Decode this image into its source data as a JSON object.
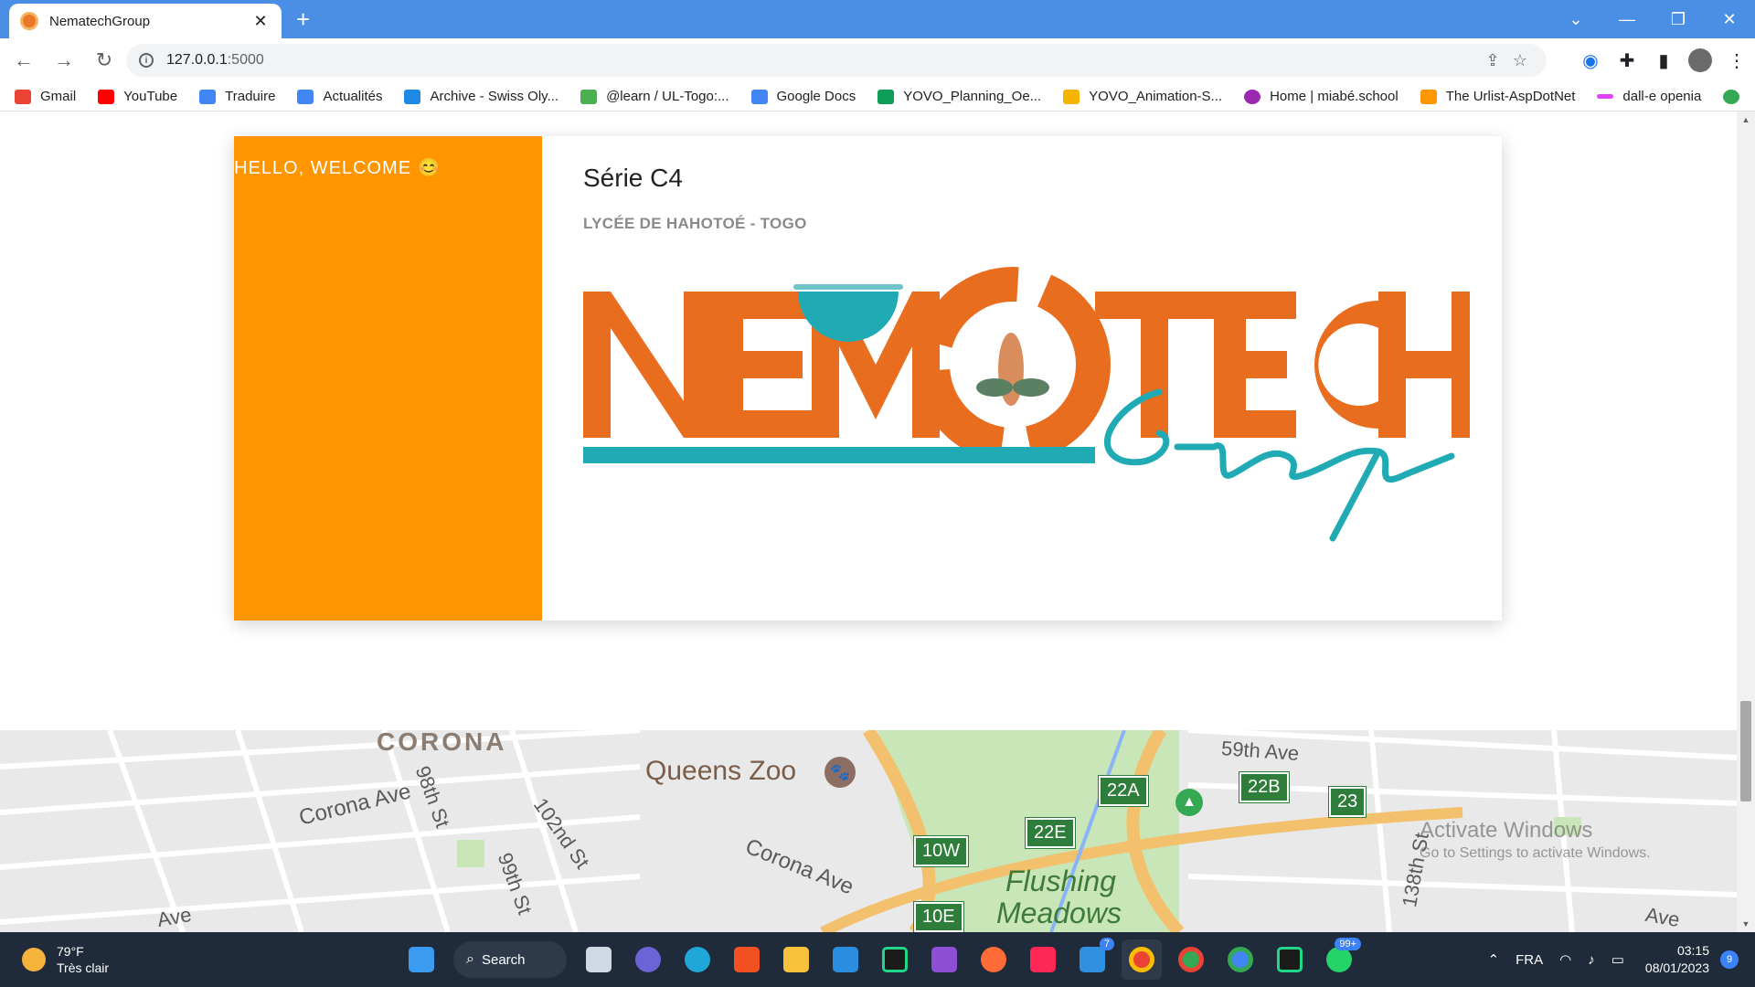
{
  "browser": {
    "tab_title": "NematechGroup",
    "tab_close": "✕",
    "new_tab": "+",
    "url_host": "127.0.0.1",
    "url_port": ":5000",
    "window_controls": [
      "⌄",
      "—",
      "❐",
      "✕"
    ],
    "nav": {
      "back": "←",
      "forward": "→",
      "reload": "↻"
    }
  },
  "bookmarks": [
    {
      "label": "Gmail",
      "color": "#ea4335"
    },
    {
      "label": "YouTube",
      "color": "#ff0000"
    },
    {
      "label": "Traduire",
      "color": "#4285f4"
    },
    {
      "label": "Actualités",
      "color": "#4285f4"
    },
    {
      "label": "Archive - Swiss Oly...",
      "color": "#1e88e5"
    },
    {
      "label": "@learn / UL-Togo:...",
      "color": "#4caf50"
    },
    {
      "label": "Google Docs",
      "color": "#4285f4"
    },
    {
      "label": "YOVO_Planning_Oe...",
      "color": "#0f9d58"
    },
    {
      "label": "YOVO_Animation-S...",
      "color": "#f4b400"
    },
    {
      "label": "Home | miabé.school",
      "color": "#9c27b0"
    },
    {
      "label": "The Urlist-AspDotNet",
      "color": "#ff9800"
    },
    {
      "label": "dall-e openia",
      "color": "#e040fb"
    }
  ],
  "page": {
    "welcome": "HELLO, WELCOME 😊",
    "serie": "Série C4",
    "school": "LYCÉE DE HAHOTOÉ - TOGO",
    "logo_text": "NEMATECH",
    "logo_script": "Group",
    "brand_orange": "#e96d1f",
    "brand_teal": "#20aab4",
    "sidebar_color": "#ff9500"
  },
  "map": {
    "labels": {
      "corona": "CORONA",
      "queens_zoo": "Queens Zoo",
      "fifty_ninth": "59th Ave",
      "corona_ave_1": "Corona Ave",
      "ninety_eighth": "98th St",
      "hundred_second": "102nd St",
      "ninety_ninth": "99th St",
      "corona_ave_2": "Corona Ave",
      "flushing": "Flushing",
      "meadows": "Meadows",
      "one_thirty_eighth": "138th St",
      "ave_1": "Ave",
      "ave_2": "Ave"
    },
    "exits": [
      "22A",
      "22B",
      "23",
      "22E",
      "10W",
      "10E"
    ]
  },
  "watermark": {
    "line1": "Activate Windows",
    "line2": "Go to Settings to activate Windows."
  },
  "taskbar": {
    "temperature": "79°F",
    "weather_desc": "Très clair",
    "search_label": "Search",
    "language": "FRA",
    "time": "03:15",
    "date": "08/01/2023",
    "notifications": "9",
    "badge_steam": "7",
    "badge_whatsapp": "99+"
  }
}
